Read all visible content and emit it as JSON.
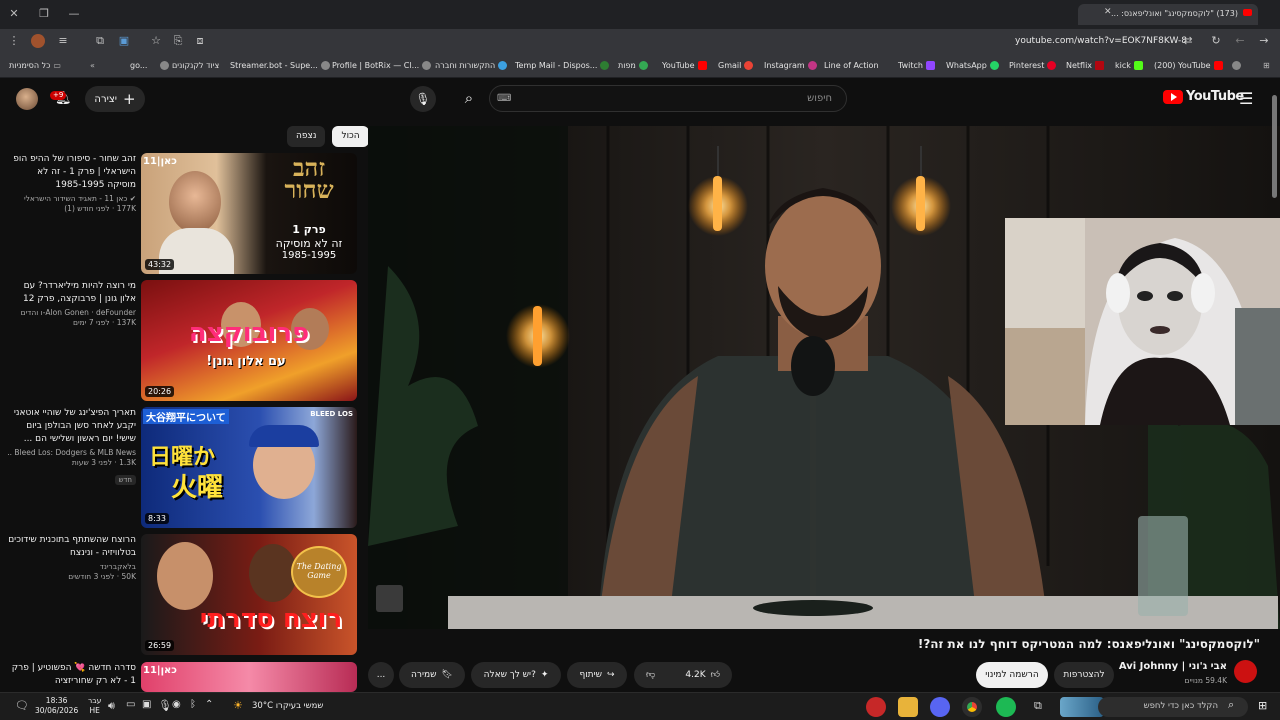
{
  "browser": {
    "tab_title": "(173) \"לוקסמקסינג\" ואונליפאנס: ...",
    "url": "youtube.com/watch?v=EOK7NF8KW-8",
    "bookmarks": [
      "כל הסימניות",
      "go...",
      "ציוד לקנקונים",
      "Streamer.bot - Supe...",
      "Profile | BotRix — Cl...",
      "התקשורות וחברה",
      "Temp Mail - Dispos...",
      "מפות",
      "YouTube",
      "Gmail",
      "Instagram",
      "Line of Action",
      "Twitch",
      "WhatsApp",
      "Pinterest",
      "Netflix",
      "kick",
      "(200) YouTube"
    ]
  },
  "header": {
    "logo": "YouTube",
    "search_placeholder": "חיפוש",
    "create_label": "יצירה",
    "notif_count": "+9"
  },
  "chips": [
    "הכול",
    "נצפה"
  ],
  "recs": [
    {
      "title": "זהב שחור - סיפורו של ההיפ הופ הישראלי | פרק 1 - זה לא מוסיקה 1985-1995",
      "channel": "כאן 11 - תאגיד השידור הישראלי",
      "meta": "177K · לפני חודש (1)",
      "duration": "43:32",
      "thumb_text": [
        "זהב שחור",
        "פרק 1",
        "זה לא מוסיקה",
        "1985-1995"
      ],
      "logo": "כאן|11"
    },
    {
      "title": "מי רוצה להיות מיליארדר? עם אלון גונן | פרבוקצה, פרק 12",
      "channel": "Alon Gonen · deFounder-ו והדים",
      "meta": "137K · לפני 7 ימים",
      "duration": "20:26",
      "thumb_text": [
        "פרובוקצה",
        "עם אלון גונן!"
      ]
    },
    {
      "title": "תאריך הפיצ'ינג של שוהיי אוטאני יקבע לאחר סשן הבולפן ביום שישי! יום ראשון ושלישי הם ...",
      "channel": "Bleed Los: Dodgers & MLB News ...",
      "meta": "1.3K · לפני 3 שעות",
      "badge": "חדש",
      "duration": "8:33",
      "thumb_text": [
        "大谷翔平について",
        "日曜か",
        "火曜",
        "BLEED LOS"
      ]
    },
    {
      "title": "הרוצח שהשתתף בתוכנית שידוכים בטלוויזיה - ונינצח",
      "channel": "בלאקברינד",
      "meta": "50K · לפני 3 חודשים",
      "duration": "26:59",
      "thumb_text": [
        "רוצח סדרתי",
        "The Dating Game"
      ]
    },
    {
      "title": "סדרה חדשה 💘 הפשוטיע | פרק 1 - לא רק שחוריזציה",
      "logo": "כאן|11"
    }
  ],
  "video": {
    "title": "\"לוקסמקסינג\" ואונליפאנס: למה המטריקס דוחף לנו את זה?!",
    "channel": "אבי ג'וני | Avi Johnny",
    "subs": "59.4K מנויים",
    "subscribe_label": "להצטרפות",
    "subscribed_label": "הרשמה למינוי",
    "likes": "4.2K",
    "share_label": "שיתוף",
    "ask_label": "יש לך שאלה?",
    "save_label": "שמירה",
    "more_label": "..."
  },
  "taskbar": {
    "time": "18:36",
    "date": "30/06/2026",
    "lang_top": "עבר",
    "lang_bottom": "HE",
    "weather": "30°C  שמשי בעיקרו",
    "search_placeholder": "הקלד כאן כדי לחפש"
  },
  "colors": {
    "brand": "#ff0000",
    "bg": "#0f0f0f",
    "chip": "#272727"
  }
}
